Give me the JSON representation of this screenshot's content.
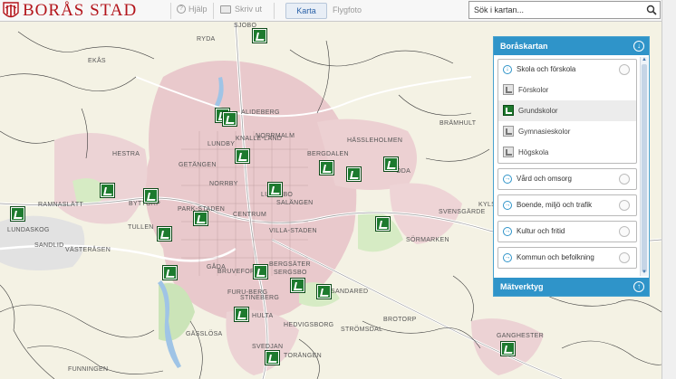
{
  "header": {
    "logo_text": "BORÅS STAD",
    "help_label": "Hjälp",
    "print_label": "Skriv ut",
    "tab_map": "Karta",
    "tab_aerial": "Flygfoto",
    "search_placeholder": "Sök i kartan..."
  },
  "panel": {
    "title": "Boråskartan",
    "groups": [
      {
        "label": "Skola och förskola",
        "expanded": true,
        "items": [
          {
            "label": "Förskolor",
            "selected": false
          },
          {
            "label": "Grundskolor",
            "selected": true
          },
          {
            "label": "Gymnasieskolor",
            "selected": false
          },
          {
            "label": "Högskola",
            "selected": false
          }
        ]
      },
      {
        "label": "Vård och omsorg"
      },
      {
        "label": "Boende, miljö och trafik"
      },
      {
        "label": "Kultur och fritid"
      },
      {
        "label": "Kommun och befolkning"
      }
    ],
    "footer": "Mätverktyg"
  },
  "map": {
    "places": [
      "RYDA",
      "EKÅS",
      "SJÖBO",
      "ALIDEBERG",
      "NORRMALM",
      "KNALLE-LAND",
      "LUNDBY",
      "HESTRA",
      "GETÄNGEN",
      "NORRBY",
      "BERGDALEN",
      "HÄSSLEHOLMEN",
      "BRÄMHULT",
      "ÖDA",
      "BYTTORP",
      "RAMNASLÄTT",
      "PARK-STADEN",
      "CENTRUM",
      "LUSSEBO",
      "SALÄNGEN",
      "SVENSGÄRDE",
      "LUNDASKOG",
      "TULLEN",
      "VILLA-STADEN",
      "SÖRMARKEN",
      "SANDLID",
      "VÄSTERÅSEN",
      "GÅDA",
      "BERGSÄTER",
      "BRUVEFORS",
      "SERGSBO",
      "KYLS",
      "FURU-BERG",
      "STINEBERG",
      "HULTA",
      "HEDVIGSBORG",
      "BROTORP",
      "STRÖMSDAL",
      "GÄSSLÖSA",
      "SVEDJAN",
      "GANGHESTER",
      "FUNNINGEN",
      "TORÄNGEN",
      "SANDARED"
    ],
    "school_count": 27
  },
  "colors": {
    "accent": "#2f94c9",
    "brand": "#b3141b",
    "school_marker": "#1d7a2e",
    "map_bg": "#f4f2e4"
  }
}
